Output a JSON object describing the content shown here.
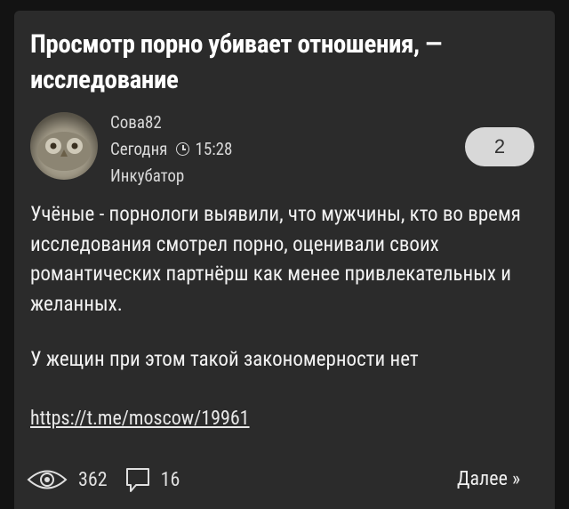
{
  "post": {
    "title": "Просмотр порно убивает отношения, — исследование",
    "author": "Сова82",
    "date": "Сегодня",
    "time": "15:28",
    "section": "Инкубатор",
    "badge_count": "2",
    "body": "Учёные - порнологи выявили, что мужчины, кто во время исследования смотрел порно, оценивали своих романтических партнёрш как менее привлекательных и желанных.",
    "body2": "У жещин при этом такой закономерности нет",
    "link": "https://t.me/moscow/19961",
    "views": "362",
    "comments": "16",
    "more": "Далее »"
  },
  "icons": {
    "eye": "eye-icon",
    "comment": "comment-icon",
    "clock": "clock-icon"
  }
}
